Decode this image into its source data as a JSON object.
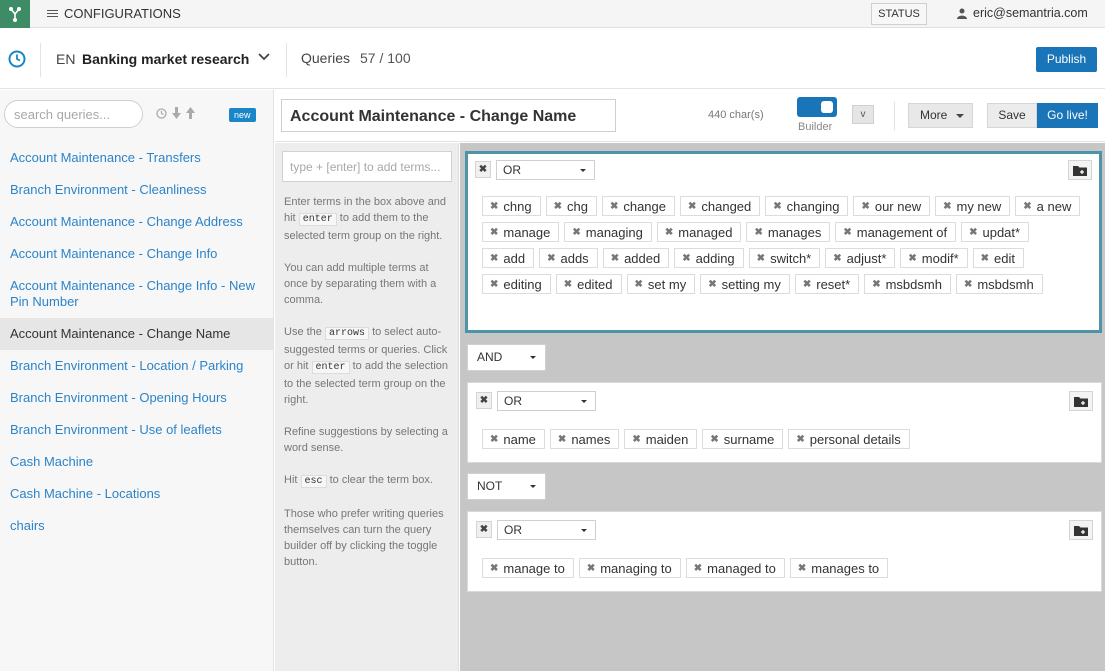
{
  "topbar": {
    "menu_label": "CONFIGURATIONS",
    "status_label": "STATUS",
    "user_email": "eric@semantria.com"
  },
  "project": {
    "lang": "EN",
    "name": "Banking market research",
    "queries_label": "Queries",
    "queries_count": "57 / 100",
    "publish_label": "Publish"
  },
  "sidebar": {
    "search_placeholder": "search queries...",
    "new_badge": "new",
    "items": [
      {
        "label": "Account Maintenance - Transfers"
      },
      {
        "label": "Branch Environment - Cleanliness"
      },
      {
        "label": "Account Maintenance - Change Address"
      },
      {
        "label": "Account Maintenance - Change Info"
      },
      {
        "label": "Account Maintenance - Change Info - New Pin Number"
      },
      {
        "label": "Account Maintenance - Change Name",
        "active": true
      },
      {
        "label": "Branch Environment - Location / Parking"
      },
      {
        "label": "Branch Environment - Opening Hours"
      },
      {
        "label": "Branch Environment - Use of leaflets"
      },
      {
        "label": "Cash Machine"
      },
      {
        "label": "Cash Machine - Locations"
      },
      {
        "label": "chairs"
      }
    ]
  },
  "editor": {
    "query_name": "Account Maintenance - Change Name",
    "char_count": "440 char(s)",
    "builder_label": "Builder",
    "v_label": "v",
    "more_label": "More",
    "save_label": "Save",
    "golive_label": "Go live!",
    "term_placeholder": "type + [enter] to add terms...",
    "help": {
      "p1a": "Enter terms in the box above and hit",
      "p1code": "enter",
      "p1b": "to add them to the selected term group on the right.",
      "p2": "You can add multiple terms at once by separating them with a comma.",
      "p3a": "Use the",
      "p3code": "arrows",
      "p3b": "to select auto-suggested terms or queries. Click or hit",
      "p3code2": "enter",
      "p3c": "to add the selection to the selected term group on the right.",
      "p4": "Refine suggestions by selecting a word sense.",
      "p5a": "Hit",
      "p5code": "esc",
      "p5b": "to clear the term box.",
      "p6": "Those who prefer writing queries themselves can turn the query builder off by clicking the toggle button."
    }
  },
  "groups": [
    {
      "operator": "OR",
      "terms": [
        "chng",
        "chg",
        "change",
        "changed",
        "changing",
        "our new",
        "my new",
        "a new",
        "manage",
        "managing",
        "managed",
        "manages",
        "management of",
        "updat*",
        "add",
        "adds",
        "added",
        "adding",
        "switch*",
        "adjust*",
        "modif*",
        "edit",
        "editing",
        "edited",
        "set my",
        "setting my",
        "reset*",
        "msbdsmh",
        "msbdsmh"
      ]
    },
    {
      "connector": "AND",
      "operator": "OR",
      "terms": [
        "name",
        "names",
        "maiden",
        "surname",
        "personal details"
      ]
    },
    {
      "connector": "NOT",
      "operator": "OR",
      "terms": [
        "manage to",
        "managing to",
        "managed to",
        "manages to"
      ]
    }
  ],
  "colors": {
    "accent": "#1a75b8",
    "logo_green": "#3d8c66",
    "link": "#2b84c9",
    "selected_group_border": "#4d94a8"
  }
}
